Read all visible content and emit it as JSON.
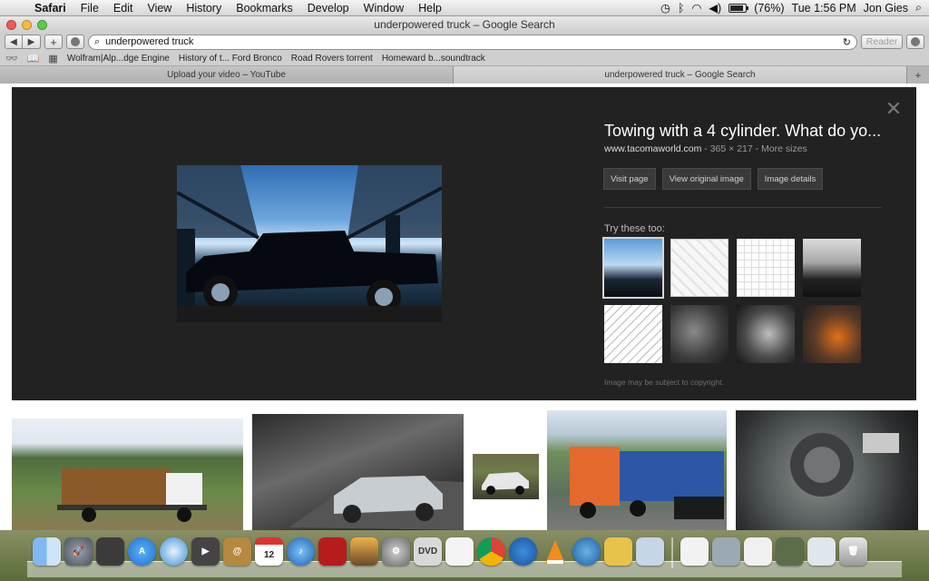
{
  "menubar": {
    "app": "Safari",
    "items": [
      "File",
      "Edit",
      "View",
      "History",
      "Bookmarks",
      "Develop",
      "Window",
      "Help"
    ],
    "battery": "(76%)",
    "clock": "Tue 1:56 PM",
    "user": "Jon Gies"
  },
  "window": {
    "title": "underpowered truck – Google Search"
  },
  "toolbar": {
    "address": "underpowered truck",
    "reader": "Reader"
  },
  "bookmarks": [
    "Wolfram|Alp...dge Engine",
    "History of t... Ford Bronco",
    "Road Rovers torrent",
    "Homeward b...soundtrack"
  ],
  "tabs": [
    {
      "label": "Upload your video – YouTube",
      "active": false
    },
    {
      "label": "underpowered truck – Google Search",
      "active": true
    }
  ],
  "preview": {
    "title": "Towing with a 4 cylinder. What do yo...",
    "site": "www.tacomaworld.com",
    "meta": " - 365 × 217 - More sizes",
    "buttons": [
      "Visit page",
      "View original image",
      "Image details"
    ],
    "try_label": "Try these too:",
    "copyright": "Image may be subject to copyright."
  },
  "dock": {
    "icons": [
      "finder-icon",
      "launchpad-icon",
      "dashboard-icon",
      "app-store-icon",
      "safari-icon",
      "facetime-icon",
      "contacts-icon",
      "calendar-icon",
      "itunes-icon",
      "photo-booth-icon",
      "iphoto-icon",
      "system-preferences-icon",
      "dvd-player-icon",
      "textedit-icon",
      "chrome-icon",
      "youtube-icon",
      "vlc-icon",
      "network-icon",
      "script-icon",
      "preview-icon"
    ],
    "calendar_day": "12"
  }
}
